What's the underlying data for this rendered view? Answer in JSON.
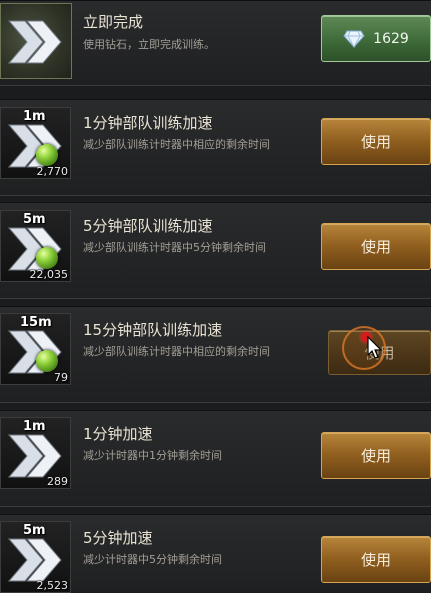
{
  "items": [
    {
      "id": "instant",
      "title": "立即完成",
      "desc": "使用钻石，立即完成训练。",
      "duration": "",
      "count": "",
      "button": "",
      "gem_cost": "1629"
    },
    {
      "id": "troop-1m",
      "title": "1分钟部队训练加速",
      "desc": "减少部队训练计时器中相应的剩余时间",
      "duration": "1m",
      "count": "2,770",
      "button": "使用"
    },
    {
      "id": "troop-5m",
      "title": "5分钟部队训练加速",
      "desc": "减少部队训练计时器中5分钟剩余时间",
      "duration": "5m",
      "count": "22,035",
      "button": "使用"
    },
    {
      "id": "troop-15m",
      "title": "15分钟部队训练加速",
      "desc": "减少部队训练计时器中相应的剩余时间",
      "duration": "15m",
      "count": "79",
      "button": "使用"
    },
    {
      "id": "speed-1m",
      "title": "1分钟加速",
      "desc": "减少计时器中1分钟剩余时间",
      "duration": "1m",
      "count": "289",
      "button": "使用"
    },
    {
      "id": "speed-5m",
      "title": "5分钟加速",
      "desc": "减少计时器中5分钟剩余时间",
      "duration": "5m",
      "count": "2,523",
      "button": "使用"
    }
  ],
  "colors": {
    "use_button": "#8f5e1f",
    "gem_button": "#3f6a3a",
    "title_text": "#e9e3d4",
    "desc_text": "#a39f97",
    "cursor_dot": "#d41a1a"
  },
  "icons": {
    "item": "double-chevron-speedup-icon",
    "orb": "green-orb-icon",
    "gem": "diamond-icon",
    "cursor": "mouse-pointer-icon"
  }
}
